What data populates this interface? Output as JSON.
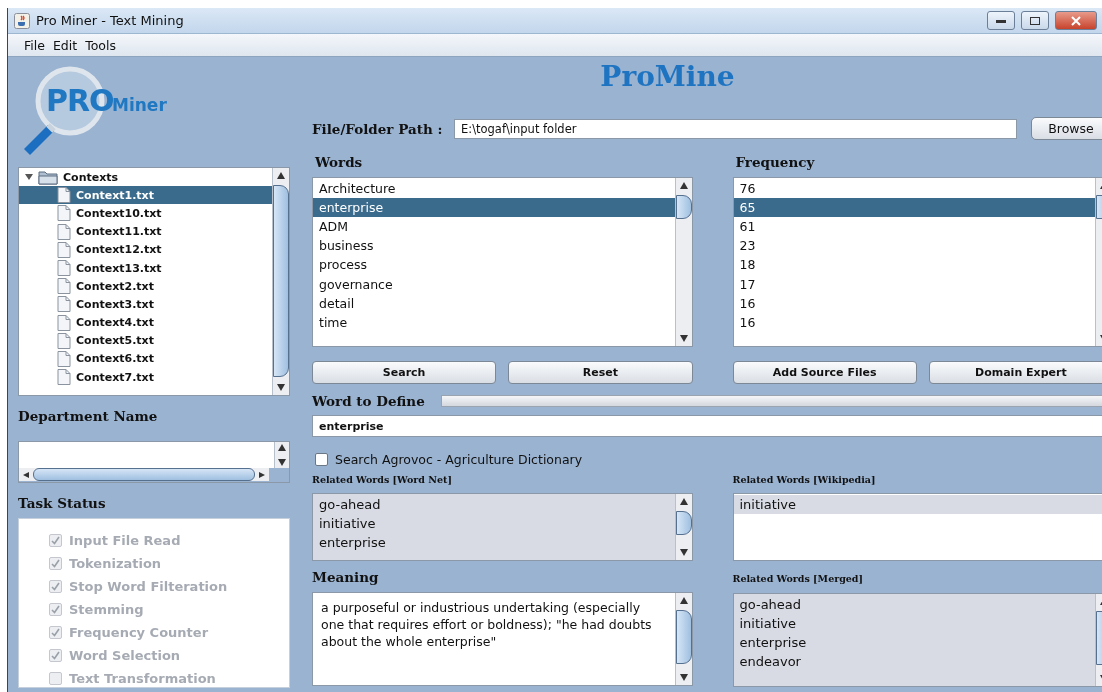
{
  "window": {
    "title": "Pro Miner - Text Mining"
  },
  "menu": [
    "File",
    "Edit",
    "Tools"
  ],
  "logo": {
    "big": "PRO",
    "small": "Miner"
  },
  "app_title": "ProMine",
  "tree": {
    "label": "Contexts",
    "expanded": true,
    "children": [
      {
        "label": "Context1.txt",
        "selected": true
      },
      {
        "label": "Context10.txt",
        "selected": false
      },
      {
        "label": "Context11.txt",
        "selected": false
      },
      {
        "label": "Context12.txt",
        "selected": false
      },
      {
        "label": "Context13.txt",
        "selected": false
      },
      {
        "label": "Context2.txt",
        "selected": false
      },
      {
        "label": "Context3.txt",
        "selected": false
      },
      {
        "label": "Context4.txt",
        "selected": false
      },
      {
        "label": "Context5.txt",
        "selected": false
      },
      {
        "label": "Context6.txt",
        "selected": false
      },
      {
        "label": "Context7.txt",
        "selected": false
      }
    ]
  },
  "department": {
    "label": "Department Name"
  },
  "task_status": {
    "label": "Task Status",
    "tasks": [
      {
        "label": "Input File Read",
        "checked": true,
        "disabled": true
      },
      {
        "label": "Tokenization",
        "checked": true,
        "disabled": true
      },
      {
        "label": "Stop Word Filteration",
        "checked": true,
        "disabled": true
      },
      {
        "label": "Stemming",
        "checked": true,
        "disabled": true
      },
      {
        "label": "Frequency Counter",
        "checked": true,
        "disabled": true
      },
      {
        "label": "Word Selection",
        "checked": true,
        "disabled": true
      },
      {
        "label": "Text Transformation",
        "checked": false,
        "disabled": true
      }
    ]
  },
  "path": {
    "label": "File/Folder Path :",
    "value": "E:\\togaf\\input folder",
    "button": "Browse"
  },
  "words": {
    "label": "Words",
    "items": [
      {
        "text": "Architecture",
        "selected": false
      },
      {
        "text": "enterprise",
        "selected": true
      },
      {
        "text": "ADM",
        "selected": false
      },
      {
        "text": "business",
        "selected": false
      },
      {
        "text": "process",
        "selected": false
      },
      {
        "text": "governance",
        "selected": false
      },
      {
        "text": "detail",
        "selected": false
      },
      {
        "text": "time",
        "selected": false
      }
    ],
    "buttons": [
      "Search",
      "Reset"
    ]
  },
  "frequency": {
    "label": "Frequency",
    "items": [
      {
        "text": "76",
        "selected": false
      },
      {
        "text": "65",
        "selected": true
      },
      {
        "text": "61",
        "selected": false
      },
      {
        "text": "23",
        "selected": false
      },
      {
        "text": "18",
        "selected": false
      },
      {
        "text": "17",
        "selected": false
      },
      {
        "text": "16",
        "selected": false
      },
      {
        "text": "16",
        "selected": false
      }
    ],
    "buttons": [
      "Add Source Files",
      "Domain Expert"
    ]
  },
  "define": {
    "label": "Word to Define",
    "value": "enterprise",
    "level": 0
  },
  "agrovoc": {
    "label": "Search Agrovoc - Agriculture Dictionary",
    "checked": false
  },
  "wordnet": {
    "label": "Related Words [Word Net]",
    "items": [
      "go-ahead",
      "initiative",
      "enterprise"
    ]
  },
  "wikipedia": {
    "label": "Related Words [Wikipedia]",
    "items": [
      "initiative"
    ]
  },
  "meaning": {
    "label": "Meaning",
    "text": "a purposeful or industrious undertaking (especially one that requires effort or boldness); \"he had doubts about the whole enterprise\""
  },
  "merged": {
    "label": "Related Words [Merged]",
    "items": [
      "go-ahead",
      "initiative",
      "enterprise",
      "endeavor"
    ]
  }
}
